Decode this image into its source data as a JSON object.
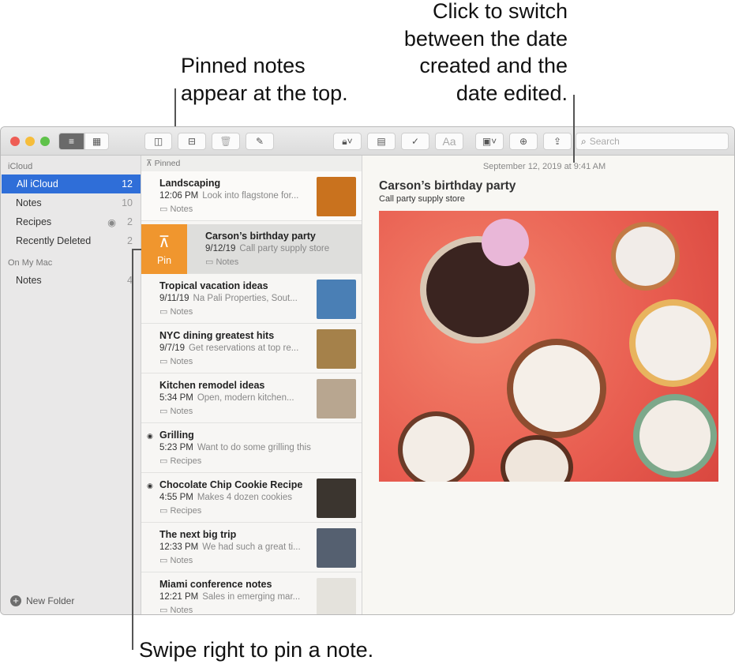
{
  "callouts": {
    "pinned_line1": "Pinned notes",
    "pinned_line2": "appear at the top.",
    "date_line1": "Click to switch",
    "date_line2": "between the date",
    "date_line3": "created and the",
    "date_line4": "date edited.",
    "swipe": "Swipe right to pin a note."
  },
  "toolbar": {
    "search_placeholder": "Search",
    "format_label": "Aa"
  },
  "sidebar": {
    "icloud_header": "iCloud",
    "mac_header": "On My Mac",
    "new_folder": "New Folder",
    "icloud_items": [
      {
        "label": "All iCloud",
        "count": "12"
      },
      {
        "label": "Notes",
        "count": "10"
      },
      {
        "label": "Recipes",
        "count": "2"
      },
      {
        "label": "Recently Deleted",
        "count": "2"
      }
    ],
    "mac_items": [
      {
        "label": "Notes",
        "count": "4"
      }
    ]
  },
  "list": {
    "pinned_header": "Pinned",
    "pin_action": "Pin",
    "notes": [
      {
        "title": "Landscaping",
        "time": "12:06 PM",
        "preview": "Look into flagstone for...",
        "folder": "Notes",
        "thumb": "#c9721e"
      },
      {
        "title": "Carson’s birthday party",
        "time": "9/12/19",
        "preview": "Call party supply store",
        "folder": "Notes"
      },
      {
        "title": "Tropical vacation ideas",
        "time": "9/11/19",
        "preview": "Na Pali Properties, Sout...",
        "folder": "Notes",
        "thumb": "#4a7fb5"
      },
      {
        "title": "NYC dining greatest hits",
        "time": "9/7/19",
        "preview": "Get reservations at top re...",
        "folder": "Notes",
        "thumb": "#a5814a"
      },
      {
        "title": "Kitchen remodel ideas",
        "time": "5:34 PM",
        "preview": "Open, modern kitchen...",
        "folder": "Notes",
        "thumb": "#b8a690"
      },
      {
        "title": "Grilling",
        "time": "5:23 PM",
        "preview": "Want to do some grilling this wee...",
        "folder": "Recipes",
        "shared": true
      },
      {
        "title": "Chocolate Chip Cookie Recipe",
        "time": "4:55 PM",
        "preview": "Makes 4 dozen cookies",
        "folder": "Recipes",
        "shared": true,
        "thumb": "#3b352f"
      },
      {
        "title": "The next big trip",
        "time": "12:33 PM",
        "preview": "We had such a great ti...",
        "folder": "Notes",
        "thumb": "#556070"
      },
      {
        "title": "Miami conference notes",
        "time": "12:21 PM",
        "preview": "Sales in emerging mar...",
        "folder": "Notes",
        "thumb": "#e4e2dc"
      }
    ]
  },
  "detail": {
    "date": "September 12, 2019 at 9:41 AM",
    "title": "Carson’s birthday party",
    "subtitle": "Call party supply store"
  }
}
